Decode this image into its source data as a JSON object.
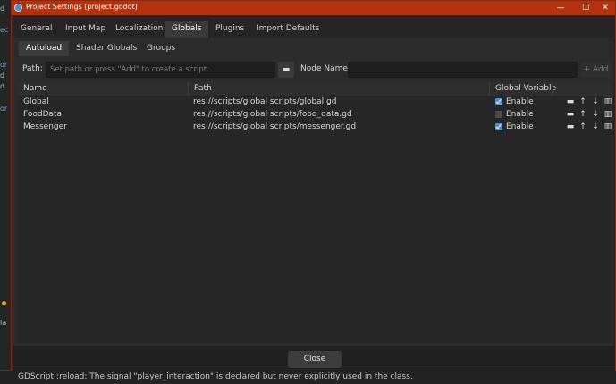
{
  "background": {
    "left_fragments": [
      "d",
      "ec",
      "or",
      "d",
      "d",
      "or",
      "la"
    ],
    "status_message": "GDScript::reload: The signal \"player_interaction\" is declared but never explicitly used in the class."
  },
  "window": {
    "title": "Project Settings (project.godot)",
    "minimize": "—",
    "maximize": "☐",
    "close": "✕",
    "accent": "#b3320d"
  },
  "tabs": [
    "General",
    "Input Map",
    "Localization",
    "Globals",
    "Plugins",
    "Import Defaults"
  ],
  "subtabs": [
    "Autoload",
    "Shader Globals",
    "Groups"
  ],
  "path_row": {
    "path_label": "Path:",
    "path_placeholder": "Set path or press \"Add\" to create a script.",
    "node_name_label": "Node Name:",
    "node_name_value": "",
    "add_label": "Add"
  },
  "table": {
    "headers": [
      "Name",
      "Path",
      "Global Variable"
    ],
    "rows": [
      {
        "name": "Global",
        "path": "res://scripts/global scripts/global.gd",
        "enabled": true,
        "enable_label": "Enable"
      },
      {
        "name": "FoodData",
        "path": "res://scripts/global scripts/food_data.gd",
        "enabled": false,
        "enable_label": "Enable"
      },
      {
        "name": "Messenger",
        "path": "res://scripts/global scripts/messenger.gd",
        "enabled": true,
        "enable_label": "Enable"
      }
    ]
  },
  "icons": {
    "folder": "folder-icon",
    "move_up": "arrow-up-icon",
    "move_down": "arrow-down-icon",
    "delete": "trash-icon"
  },
  "footer": {
    "close_label": "Close"
  }
}
